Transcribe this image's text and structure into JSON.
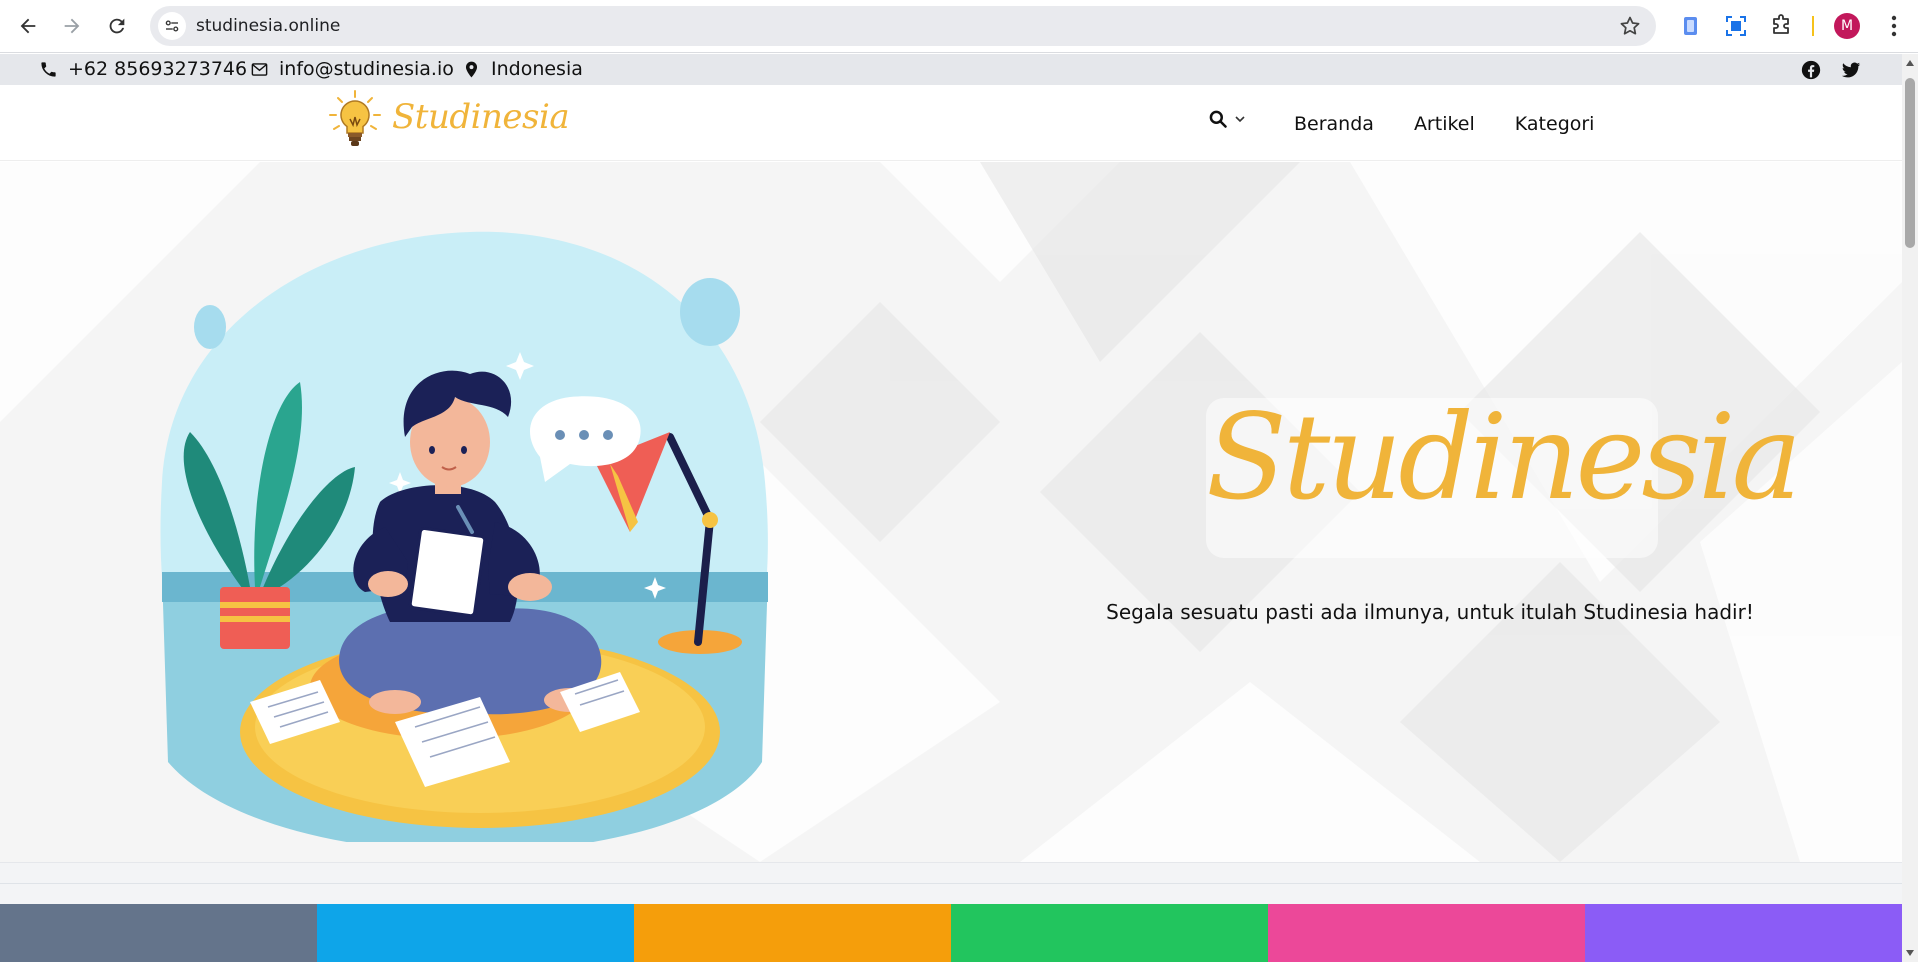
{
  "browser": {
    "url": "studinesia.online",
    "profile_initial": "M",
    "profile_color": "#c2185b",
    "icons": [
      "back-icon",
      "forward-icon",
      "reload-icon",
      "site-info-icon",
      "bookmark-star-icon",
      "extension-icon",
      "screenshot-icon",
      "puzzle-icon",
      "more-vert-icon"
    ]
  },
  "topbar": {
    "phone": "+62 85693273746",
    "email": "info@studinesia.io",
    "location": "Indonesia",
    "social": [
      "facebook-icon",
      "twitter-icon"
    ]
  },
  "header": {
    "logo_text": "Studinesia",
    "nav": [
      {
        "label": "Beranda"
      },
      {
        "label": "Artikel"
      },
      {
        "label": "Kategori"
      }
    ]
  },
  "hero": {
    "title": "Studinesia",
    "tagline": "Segala sesuatu pasti ada ilmunya, untuk itulah Studinesia hadir!"
  },
  "colors": {
    "brand": "#f0b43a",
    "strip": [
      "#64748b",
      "#0ea5e9",
      "#f59e0b",
      "#22c55e",
      "#ec4899",
      "#8b5cf6"
    ]
  }
}
